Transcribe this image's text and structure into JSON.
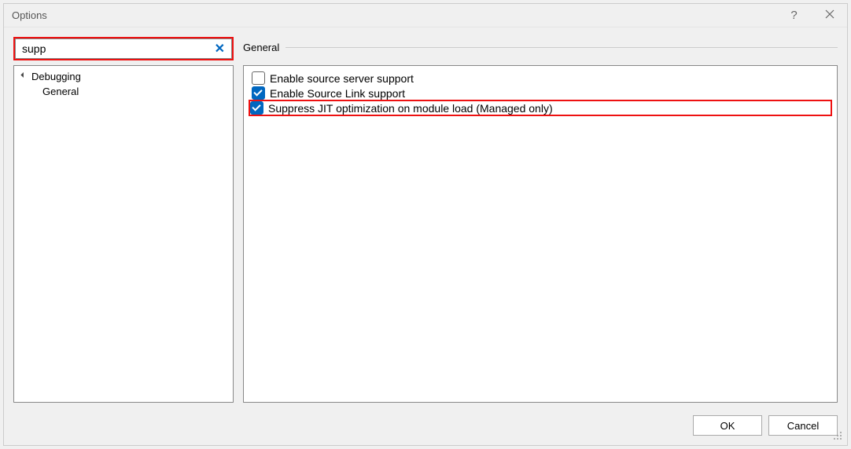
{
  "window": {
    "title": "Options"
  },
  "search": {
    "value": "supp"
  },
  "tree": {
    "root": "Debugging",
    "child": "General"
  },
  "section": {
    "title": "General"
  },
  "options": [
    {
      "label": "Enable source server support",
      "checked": false
    },
    {
      "label": "Enable Source Link support",
      "checked": true
    },
    {
      "label": "Suppress JIT optimization on module load (Managed only)",
      "checked": true,
      "highlighted": true
    }
  ],
  "buttons": {
    "ok": "OK",
    "cancel": "Cancel"
  }
}
